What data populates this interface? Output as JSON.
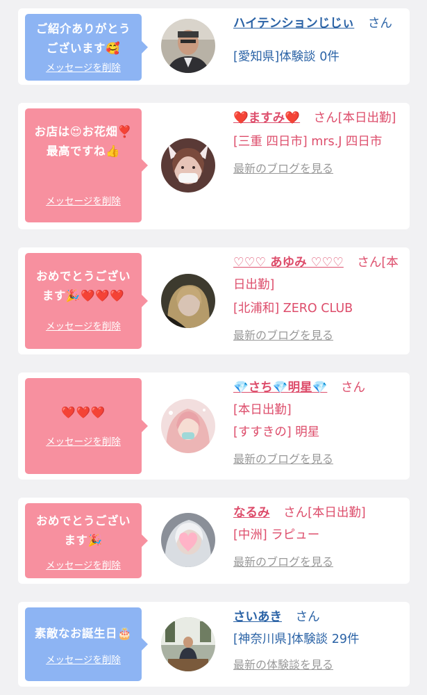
{
  "items": [
    {
      "bubble_text": "ご紹介ありがとうございます🥰",
      "delete_label": "メッセージを削除",
      "name": "ハイテンションじじぃ",
      "suffix": "さん",
      "detail_line": "[愛知県]体験談 0件",
      "more_link": "",
      "avatar": "man-portrait"
    },
    {
      "bubble_text": "お店は😍お花畑❣️最高ですね👍",
      "delete_label": "メッセージを削除",
      "name": "❤️ますみ❤️",
      "suffix": "さん[本日出勤]",
      "detail_line": "[三重 四日市] mrs.J 四日市",
      "more_link": "最新のブログを見る",
      "avatar": "cat-ear-woman"
    },
    {
      "bubble_text": "おめでとうございます🎉❤️❤️❤️",
      "delete_label": "メッセージを削除",
      "name": "♡♡♡ あゆみ ♡♡♡",
      "suffix": "さん[本日出勤]",
      "detail_line": "[北浦和] ZERO CLUB",
      "more_link": "最新のブログを見る",
      "avatar": "woman-blurred"
    },
    {
      "bubble_text": "❤️❤️❤️",
      "delete_label": "メッセージを削除",
      "name": "💎さち💎明星💎",
      "suffix": "さん",
      "detail_line_1": "[本日出勤]",
      "detail_line": "[すすきの] 明星",
      "more_link": "最新のブログを見る",
      "avatar": "woman-pink-hair"
    },
    {
      "bubble_text": "おめでとうございます🎉",
      "delete_label": "メッセージを削除",
      "name": "なるみ",
      "suffix": "さん[本日出勤]",
      "detail_line": "[中洲] ラピュー",
      "more_link": "最新のブログを見る",
      "avatar": "woman-heart-covered"
    },
    {
      "bubble_text": "素敵なお誕生日🎂",
      "delete_label": "メッセージを削除",
      "name": "さいあき",
      "suffix": "さん",
      "detail_line": "[神奈川県]体験談 29件",
      "more_link": "最新の体験談を見る",
      "avatar": "man-in-room"
    }
  ],
  "colors": {
    "blue_bubble": "#8db4f3",
    "pink_bubble": "#f7909f",
    "blue_text": "#2b63a6",
    "pink_text": "#dd4d6b",
    "link_gray": "#999999"
  }
}
